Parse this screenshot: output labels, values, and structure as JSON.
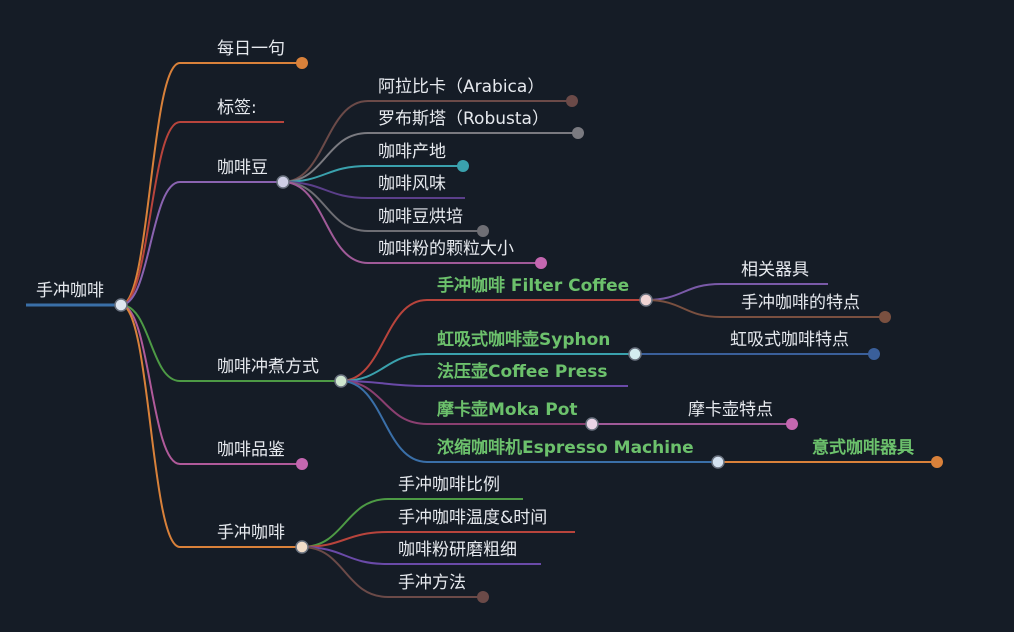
{
  "root": {
    "label": "手冲咖啡"
  },
  "branches": [
    {
      "id": "daily",
      "label": "每日一句",
      "color": "#d9813a",
      "dot": "#d9813a"
    },
    {
      "id": "tags",
      "label": "标签:",
      "color": "#b8443c"
    },
    {
      "id": "beans",
      "label": "咖啡豆",
      "color": "#8a63b0",
      "dot": "#cfcfe6",
      "children": [
        {
          "label": "阿拉比卡（Arabica）",
          "color": "#6b4a48",
          "dot": "#6b4a48"
        },
        {
          "label": "罗布斯塔（Robusta）",
          "color": "#7a7a80",
          "dot": "#7a7a80"
        },
        {
          "label": "咖啡产地",
          "color": "#3aa1ad",
          "dot": "#3aa1ad"
        },
        {
          "label": "咖啡风味",
          "color": "#5b3f8a"
        },
        {
          "label": "咖啡豆烘培",
          "color": "#6e6e74",
          "dot": "#6e6e74"
        },
        {
          "label": "咖啡粉的颗粒大小",
          "color": "#a05a98",
          "dot": "#c467b0"
        }
      ]
    },
    {
      "id": "methods",
      "label": "咖啡冲煮方式",
      "color": "#4d9a45",
      "dot": "#cfe6cf",
      "children": [
        {
          "label": "手冲咖啡 Filter Coffee",
          "color": "#b8443c",
          "dot": "#f0d4d4",
          "highlight": true,
          "children": [
            {
              "label": "相关器具",
              "color": "#7a5aa8"
            },
            {
              "label": "手冲咖啡的特点",
              "color": "#7a5040",
              "dot": "#7a5040"
            }
          ]
        },
        {
          "label": "虹吸式咖啡壶Syphon",
          "color": "#3aa1ad",
          "dot": "#d4ecf0",
          "highlight": true,
          "children": [
            {
              "label": "虹吸式咖啡特点",
              "color": "#3a5f9a",
              "dot": "#3a5f9a"
            }
          ]
        },
        {
          "label": "法压壶Coffee Press",
          "color": "#6a4aa8",
          "highlight": true
        },
        {
          "label": "摩卡壶Moka Pot",
          "color": "#8a3f70",
          "dot": "#ead4e6",
          "highlight": true,
          "children": [
            {
              "label": "摩卡壶特点",
              "color": "#a05a98",
              "dot": "#c467b0"
            }
          ]
        },
        {
          "label": "浓缩咖啡机Espresso Machine",
          "color": "#3a6fa8",
          "dot": "#d4e2f0",
          "highlight": true,
          "children": [
            {
              "label": "意式咖啡器具",
              "color": "#d9813a",
              "dot": "#d9813a",
              "highlight": true
            }
          ]
        }
      ]
    },
    {
      "id": "tasting",
      "label": "咖啡品鉴",
      "color": "#b05a9a",
      "dot": "#c467b0"
    },
    {
      "id": "pourover",
      "label": "手冲咖啡",
      "color": "#d9813a",
      "dot": "#f0dcc8",
      "children": [
        {
          "label": "手冲咖啡比例",
          "color": "#4d9a45"
        },
        {
          "label": "手冲咖啡温度&时间",
          "color": "#b8443c"
        },
        {
          "label": "咖啡粉研磨粗细",
          "color": "#6a4aa8"
        },
        {
          "label": "手冲方法",
          "color": "#6b4a48",
          "dot": "#6b4a48"
        }
      ]
    }
  ]
}
